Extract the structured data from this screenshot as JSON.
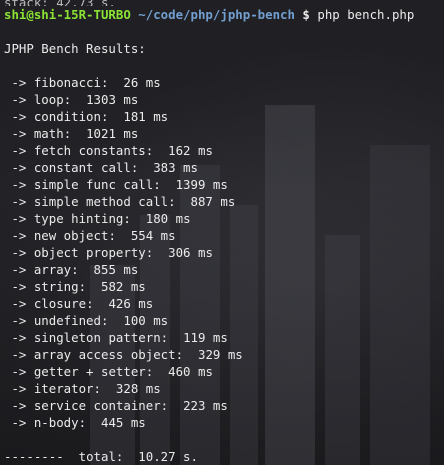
{
  "prompt": {
    "user_host": "shi@shi-15R-TURBO",
    "path": "~/code/php/jphp-bench",
    "symbol": "$",
    "command": "php bench.php"
  },
  "top_partial": "stack: 42.73 s.",
  "header": "JPHP Bench Results:",
  "results": [
    {
      "name": "fibonacci",
      "value": "26 ms"
    },
    {
      "name": "loop",
      "value": "1303 ms"
    },
    {
      "name": "condition",
      "value": "181 ms"
    },
    {
      "name": "math",
      "value": "1021 ms"
    },
    {
      "name": "fetch constants",
      "value": "162 ms"
    },
    {
      "name": "constant call",
      "value": "383 ms"
    },
    {
      "name": "simple func call",
      "value": "1399 ms"
    },
    {
      "name": "simple method call",
      "value": "887 ms"
    },
    {
      "name": "type hinting",
      "value": "180 ms"
    },
    {
      "name": "new object",
      "value": "554 ms"
    },
    {
      "name": "object property",
      "value": "306 ms"
    },
    {
      "name": "array",
      "value": "855 ms"
    },
    {
      "name": "string",
      "value": "582 ms"
    },
    {
      "name": "closure",
      "value": "426 ms"
    },
    {
      "name": "undefined",
      "value": "100 ms"
    },
    {
      "name": "singleton pattern",
      "value": "119 ms"
    },
    {
      "name": "array access object",
      "value": "329 ms"
    },
    {
      "name": "getter + setter",
      "value": "460 ms"
    },
    {
      "name": "iterator",
      "value": "328 ms"
    },
    {
      "name": "service container",
      "value": "223 ms"
    },
    {
      "name": "n-body",
      "value": "445 ms"
    }
  ],
  "arrow": " -> ",
  "total": {
    "dashes": "--------",
    "label": "total:",
    "value": "10.27 s."
  }
}
